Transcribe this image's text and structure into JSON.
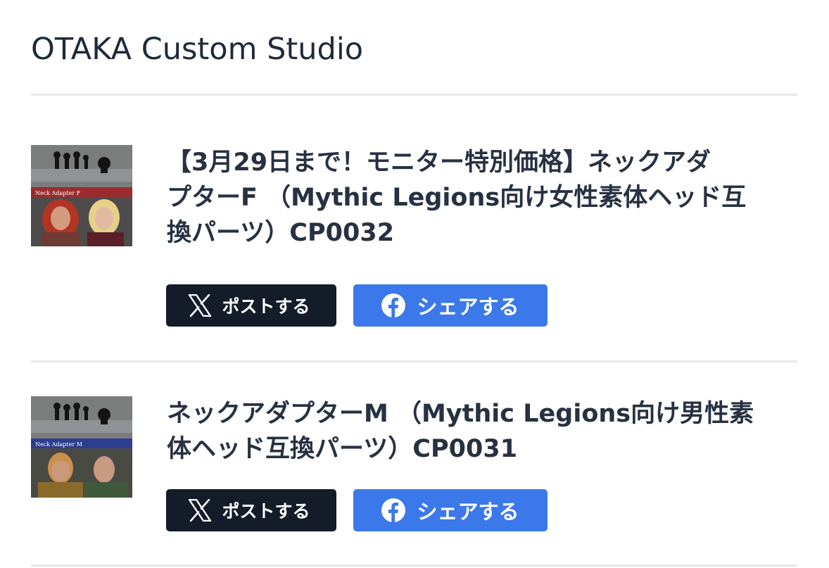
{
  "shop": {
    "title": "OTAKA Custom Studio"
  },
  "items": [
    {
      "title_lines": [
        "【3月29日まで！モニター特別価格】ネックアダ",
        "プターF （Mythic Legions向け女性素体ヘッド互",
        "換パーツ）CP0032"
      ],
      "thumbnail": {
        "banner_text": "Neck Adapter F",
        "banner_color": "#9b2b2f",
        "icon": "product-image"
      },
      "share_x_label": "ポストする",
      "share_fb_label": "シェアする"
    },
    {
      "title_lines": [
        "ネックアダプターM （Mythic Legions向け男性素",
        "体ヘッド互換パーツ）CP0031"
      ],
      "thumbnail": {
        "banner_text": "Neck Adapter M",
        "banner_color": "#2d3d8f",
        "icon": "product-image"
      },
      "share_x_label": "ポストする",
      "share_fb_label": "シェアする"
    }
  ],
  "colors": {
    "x_button": "#141b29",
    "facebook_button": "#3b78ea",
    "divider": "#e6e8eb"
  }
}
